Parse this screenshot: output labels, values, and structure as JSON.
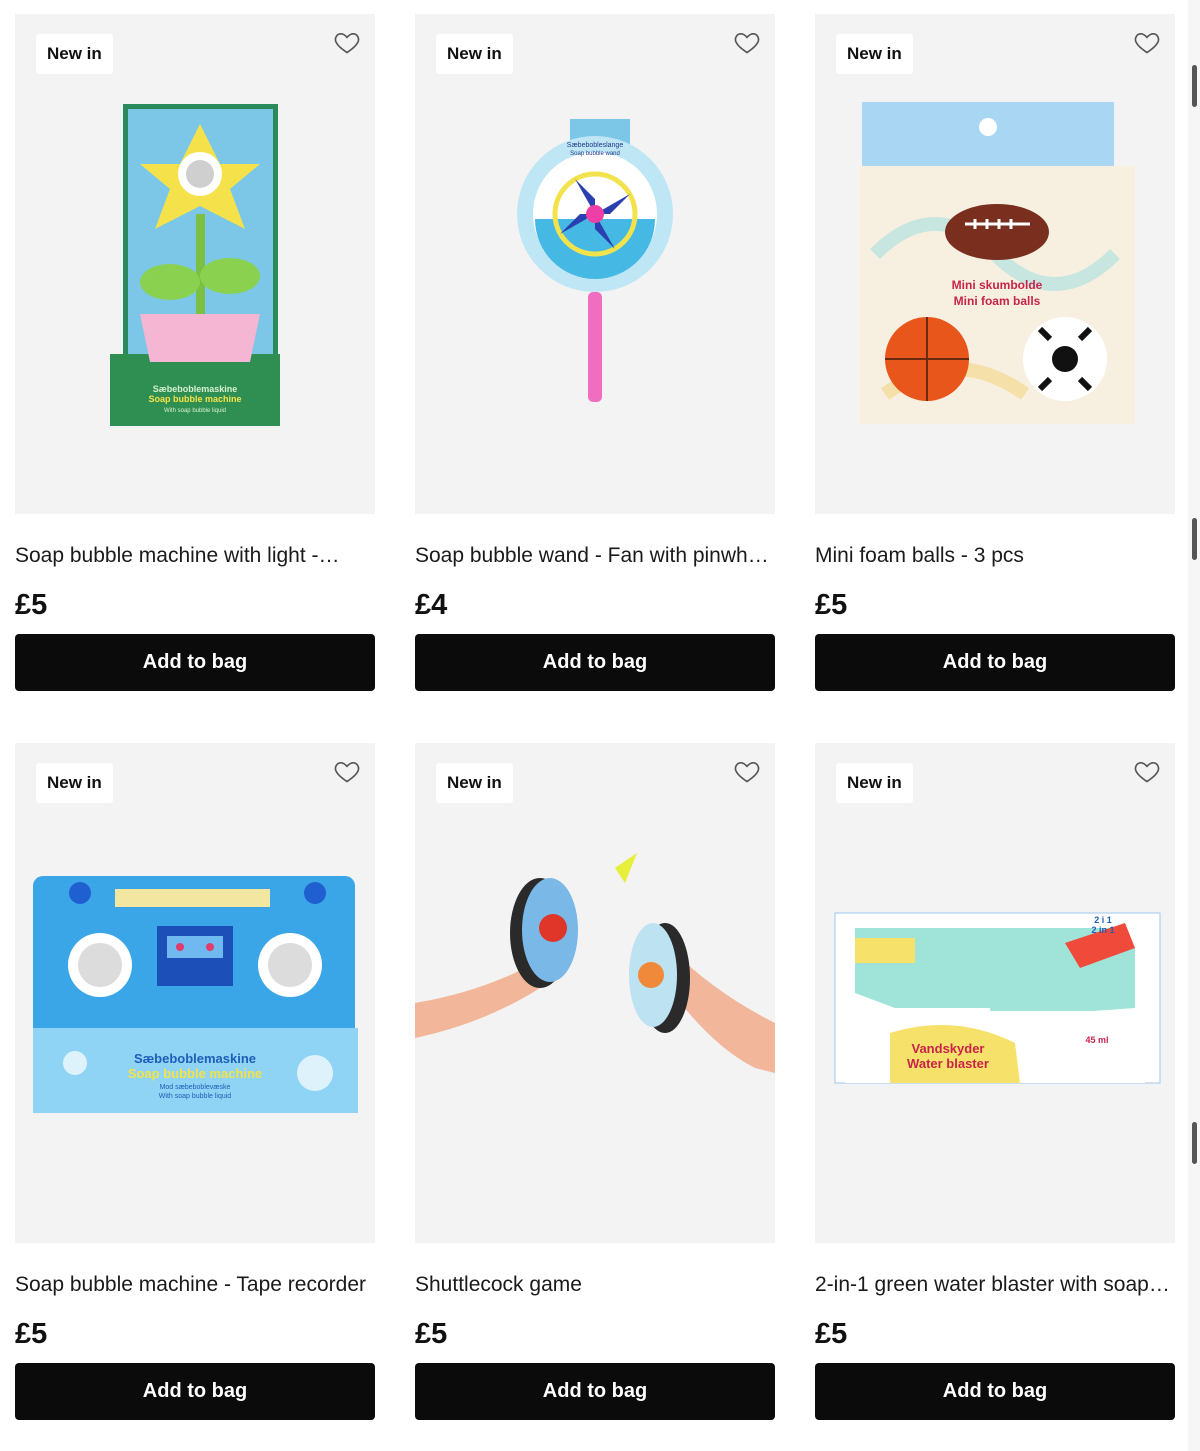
{
  "products": [
    {
      "badge": "New in",
      "name": "Soap bubble machine with light -…",
      "price": "£5",
      "cta": "Add to bag",
      "image": "flower-bubble-machine",
      "box_text_1": "Sæbeboblemaskine",
      "box_text_2": "Soap bubble machine",
      "box_text_3": "With soap bubble liquid"
    },
    {
      "badge": "New in",
      "name": "Soap bubble wand - Fan with pinwheel",
      "price": "£4",
      "cta": "Add to bag",
      "image": "bubble-wand-pinwheel",
      "box_text_1": "Sæbebobleslange",
      "box_text_2": "Soap bubble wand"
    },
    {
      "badge": "New in",
      "name": "Mini foam balls - 3 pcs",
      "price": "£5",
      "cta": "Add to bag",
      "image": "mini-foam-balls",
      "box_text_1": "Mini skumbolde",
      "box_text_2": "Mini foam balls"
    },
    {
      "badge": "New in",
      "name": "Soap bubble machine - Tape recorder",
      "price": "£5",
      "cta": "Add to bag",
      "image": "tape-recorder-bubble-machine",
      "box_text_1": "Sæbeboblemaskine",
      "box_text_2": "Soap bubble machine",
      "box_text_3": "Mod sæbeboblevæske",
      "box_text_4": "With soap bubble liquid"
    },
    {
      "badge": "New in",
      "name": "Shuttlecock game",
      "price": "£5",
      "cta": "Add to bag",
      "image": "shuttlecock-game"
    },
    {
      "badge": "New in",
      "name": "2-in-1 green water blaster with soap…",
      "price": "£5",
      "cta": "Add to bag",
      "image": "water-blaster",
      "box_text_1": "Vandskyder",
      "box_text_2": "Water blaster",
      "box_text_3": "45 ml",
      "box_text_4": "2 i 1",
      "box_text_5": "2 in 1"
    }
  ],
  "colors": {
    "button_bg": "#0b0b0b",
    "button_text": "#ffffff",
    "card_bg": "#f3f3f3"
  }
}
